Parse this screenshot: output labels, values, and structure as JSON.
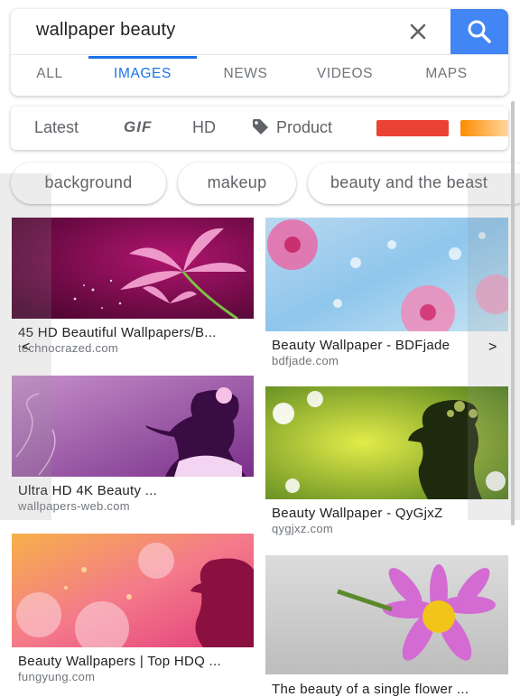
{
  "search": {
    "query": "wallpaper beauty",
    "clear_icon": "close-icon",
    "search_icon": "search-icon",
    "button_color": "#4285f4"
  },
  "tabs": [
    {
      "label": "ALL",
      "active": false
    },
    {
      "label": "IMAGES",
      "active": true
    },
    {
      "label": "NEWS",
      "active": false
    },
    {
      "label": "VIDEOS",
      "active": false
    },
    {
      "label": "MAPS",
      "active": false
    }
  ],
  "filters": {
    "latest": "Latest",
    "gif": "GIF",
    "hd": "HD",
    "product": "Product",
    "product_icon": "tag-icon",
    "color_swatches": [
      "#ea4335",
      "#fb8c00"
    ]
  },
  "chips": [
    "background",
    "makeup",
    "beauty and the beast"
  ],
  "results": [
    {
      "title": "45 HD Beautiful Wallpapers/B...",
      "source": "technocrazed.com"
    },
    {
      "title": "Beauty Wallpaper - BDFjade",
      "source": "bdfjade.com"
    },
    {
      "title": "Ultra HD 4K Beauty ...",
      "source": "wallpapers-web.com"
    },
    {
      "title": "Beauty Wallpaper - QyGjxZ",
      "source": "qygjxz.com"
    },
    {
      "title": "Beauty Wallpapers | Top HDQ ...",
      "source": "fungyung.com"
    },
    {
      "title": "The beauty of a single flower ...",
      "source": ""
    }
  ],
  "nav": {
    "prev": "<",
    "next": ">"
  },
  "accent_color": "#1a73e8"
}
